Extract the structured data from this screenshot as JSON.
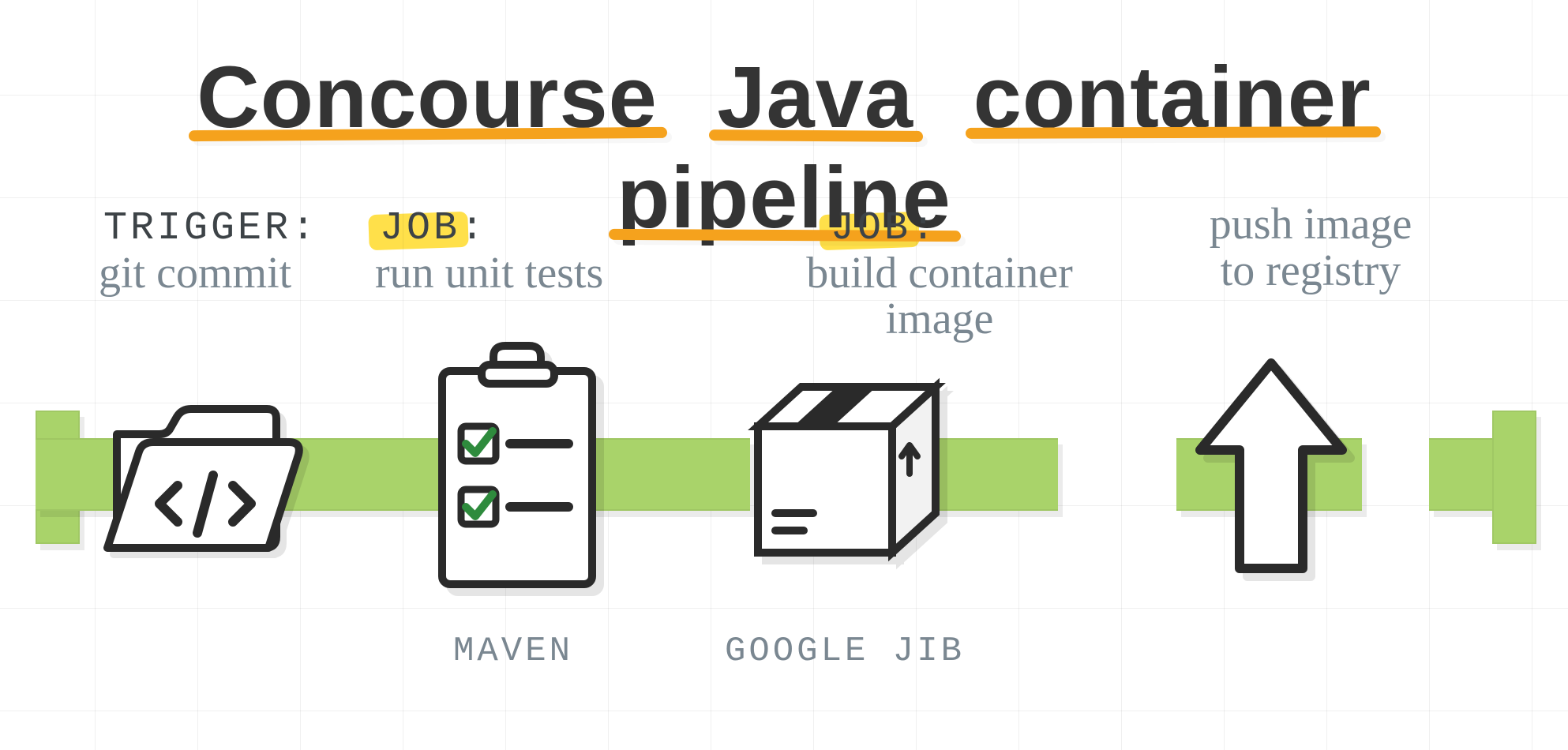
{
  "title": {
    "w1": "Concourse",
    "w2": "Java",
    "w3": "container",
    "w4": "pipeline"
  },
  "stages": [
    {
      "head": "TRIGGER:",
      "sub": "git commit",
      "highlight": false
    },
    {
      "head": "JOB:",
      "sub": "run unit tests",
      "tool": "MAVEN",
      "highlight": true
    },
    {
      "head": "JOB:",
      "sub": "build container\nimage",
      "tool": "GOOGLE JIB",
      "highlight": true
    },
    {
      "head": "",
      "sub": "push image\nto registry",
      "highlight": false
    }
  ],
  "palette": {
    "green": "#a9d36a",
    "orange": "#f5a21d",
    "yellow": "#ffe04a",
    "ink": "#2b2b2b",
    "grey": "#7a8791"
  }
}
